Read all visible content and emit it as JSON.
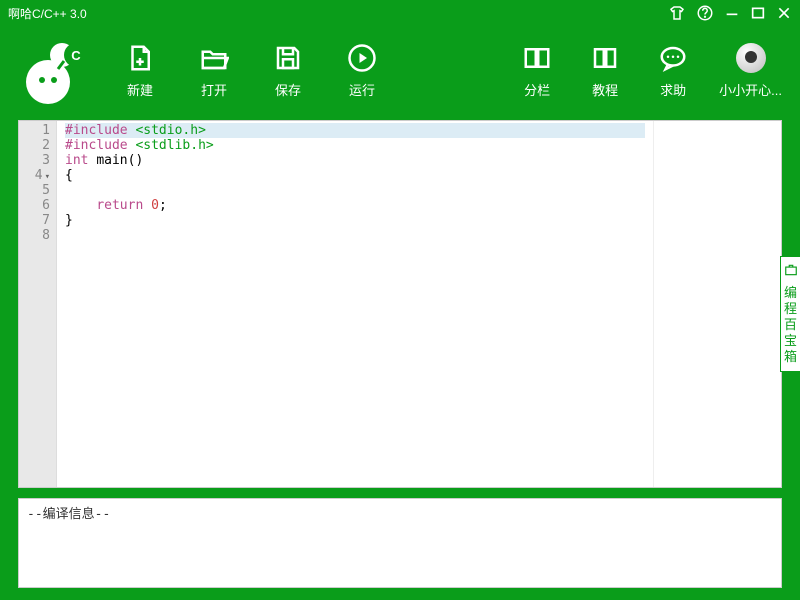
{
  "window": {
    "title": "啊哈C/C++ 3.0"
  },
  "toolbar": {
    "left": [
      {
        "id": "new",
        "label": "新建"
      },
      {
        "id": "open",
        "label": "打开"
      },
      {
        "id": "save",
        "label": "保存"
      },
      {
        "id": "run",
        "label": "运行"
      }
    ],
    "right": [
      {
        "id": "split",
        "label": "分栏"
      },
      {
        "id": "tutorial",
        "label": "教程"
      },
      {
        "id": "help",
        "label": "求助"
      },
      {
        "id": "user",
        "label": "小小开心..."
      }
    ]
  },
  "editor": {
    "lines": [
      {
        "n": 1,
        "segments": [
          {
            "t": "#include ",
            "c": "kw"
          },
          {
            "t": "<stdio.h>",
            "c": "inc"
          }
        ],
        "highlight": true
      },
      {
        "n": 2,
        "segments": [
          {
            "t": "#include ",
            "c": "kw"
          },
          {
            "t": "<stdlib.h>",
            "c": "inc"
          }
        ]
      },
      {
        "n": 3,
        "segments": [
          {
            "t": "int ",
            "c": "kw"
          },
          {
            "t": "main()",
            "c": ""
          }
        ]
      },
      {
        "n": 4,
        "segments": [
          {
            "t": "{",
            "c": ""
          }
        ],
        "fold": true
      },
      {
        "n": 5,
        "segments": [
          {
            "t": "",
            "c": ""
          }
        ]
      },
      {
        "n": 6,
        "segments": [
          {
            "t": "    ",
            "c": ""
          },
          {
            "t": "return ",
            "c": "kw"
          },
          {
            "t": "0",
            "c": "num"
          },
          {
            "t": ";",
            "c": ""
          }
        ]
      },
      {
        "n": 7,
        "segments": [
          {
            "t": "}",
            "c": ""
          }
        ]
      },
      {
        "n": 8,
        "segments": [
          {
            "t": "",
            "c": ""
          }
        ]
      }
    ]
  },
  "output": {
    "text": "--编译信息--"
  },
  "side_tab": {
    "label": "编程百宝箱"
  }
}
